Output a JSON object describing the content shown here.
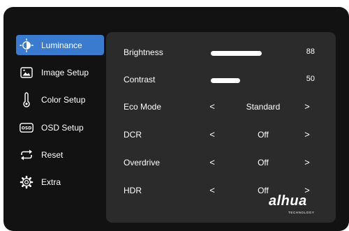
{
  "colors": {
    "background": "#121212",
    "panel": "#2b2b2b",
    "accent": "#3a7bd0",
    "text": "#ffffff"
  },
  "sidebar": {
    "items": [
      {
        "label": "Luminance",
        "icon": "brightness-icon",
        "active": true
      },
      {
        "label": "Image Setup",
        "icon": "image-icon",
        "active": false
      },
      {
        "label": "Color Setup",
        "icon": "thermometer-icon",
        "active": false
      },
      {
        "label": "OSD Setup",
        "icon": "osd-icon",
        "active": false
      },
      {
        "label": "Reset",
        "icon": "reset-arrows-icon",
        "active": false
      },
      {
        "label": "Extra",
        "icon": "gear-icon",
        "active": false
      }
    ]
  },
  "settings": {
    "brightness": {
      "label": "Brightness",
      "value": "88",
      "percent": 88
    },
    "contrast": {
      "label": "Contrast",
      "value": "50",
      "percent": 50
    },
    "eco_mode": {
      "label": "Eco Mode",
      "value": "Standard",
      "prev": "<",
      "next": ">"
    },
    "dcr": {
      "label": "DCR",
      "value": "Off",
      "prev": "<",
      "next": ">"
    },
    "overdrive": {
      "label": "Overdrive",
      "value": "Off",
      "prev": "<",
      "next": ">"
    },
    "hdr": {
      "label": "HDR",
      "value": "Off",
      "prev": "<",
      "next": ">"
    }
  },
  "brand": {
    "name": "alhua",
    "tagline": "TECHNOLOGY"
  }
}
